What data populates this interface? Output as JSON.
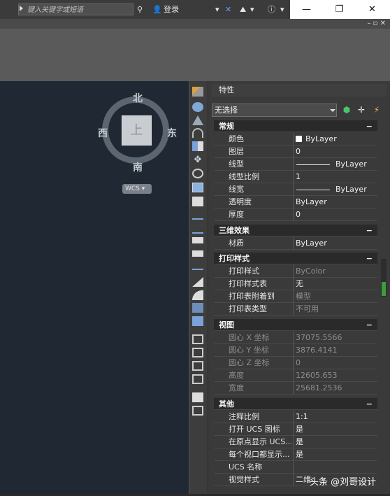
{
  "titlebar": {
    "search_placeholder": "键入关键字或短语",
    "login_label": "登录",
    "minimize": "—",
    "maximize": "❐",
    "close": "✕"
  },
  "menustrip": {
    "controls": "– ▫ ✕"
  },
  "viewport": {
    "compass": {
      "north": "北",
      "south": "南",
      "east": "东",
      "west": "西",
      "face": "上"
    },
    "wcs_label": "WCS"
  },
  "properties": {
    "title": "特性",
    "selection": "无选择",
    "sections": {
      "general": {
        "title": "常规",
        "rows": [
          {
            "key": "颜色",
            "value": "ByLayer"
          },
          {
            "key": "图层",
            "value": "0"
          },
          {
            "key": "线型",
            "value": "ByLayer"
          },
          {
            "key": "线型比例",
            "value": "1"
          },
          {
            "key": "线宽",
            "value": "ByLayer"
          },
          {
            "key": "透明度",
            "value": "ByLayer"
          },
          {
            "key": "厚度",
            "value": "0"
          }
        ]
      },
      "threed": {
        "title": "三维效果",
        "rows": [
          {
            "key": "材质",
            "value": "ByLayer"
          }
        ]
      },
      "plot": {
        "title": "打印样式",
        "rows": [
          {
            "key": "打印样式",
            "value": "ByColor"
          },
          {
            "key": "打印样式表",
            "value": "无"
          },
          {
            "key": "打印表附着到",
            "value": "模型"
          },
          {
            "key": "打印表类型",
            "value": "不可用"
          }
        ]
      },
      "view": {
        "title": "视图",
        "rows": [
          {
            "key": "圆心 X 坐标",
            "value": "37075.5566"
          },
          {
            "key": "圆心 Y 坐标",
            "value": "3876.4141"
          },
          {
            "key": "圆心 Z 坐标",
            "value": "0"
          },
          {
            "key": "高度",
            "value": "12605.653"
          },
          {
            "key": "宽度",
            "value": "25681.2536"
          }
        ]
      },
      "misc": {
        "title": "其他",
        "rows": [
          {
            "key": "注释比例",
            "value": "1:1"
          },
          {
            "key": "打开 UCS 图标",
            "value": "是"
          },
          {
            "key": "在原点显示 UCS...",
            "value": "是"
          },
          {
            "key": "每个视口都显示...",
            "value": "是"
          },
          {
            "key": "UCS 名称",
            "value": ""
          },
          {
            "key": "视觉样式",
            "value": "二维"
          }
        ]
      }
    }
  },
  "watermark": "头条 @刘哥设计",
  "colors": {
    "accent_green": "#3f9b3f",
    "viewport_bg": "#1f2833",
    "panel_bg": "#3a3a3a"
  }
}
